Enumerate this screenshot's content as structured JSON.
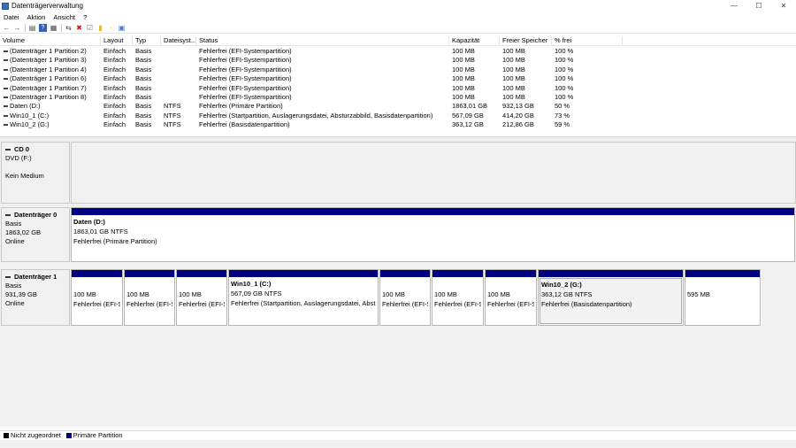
{
  "window": {
    "title": "Datenträgerverwaltung",
    "minimize": "—",
    "maximize": "☐",
    "close": "✕"
  },
  "menu": [
    "Datei",
    "Aktion",
    "Ansicht",
    "?"
  ],
  "toolbar": {
    "back": "←",
    "forward": "→",
    "list": "▤",
    "help": "?",
    "panes": "▦",
    "connect": "⇆",
    "delete": "✖",
    "properties": "☑",
    "folder": "▮",
    "new": "▫",
    "help2": "▣"
  },
  "volume_table": {
    "headers": {
      "volume": "Volume",
      "layout": "Layout",
      "type": "Typ",
      "fs": "Dateisyst...",
      "status": "Status",
      "capacity": "Kapazität",
      "free": "Freier Speicher",
      "pct": "% frei"
    },
    "rows": [
      {
        "volume": "(Datenträger 1 Partition 2)",
        "layout": "Einfach",
        "type": "Basis",
        "fs": "",
        "status": "Fehlerfrei (EFI-Systempartition)",
        "capacity": "100 MB",
        "free": "100 MB",
        "pct": "100 %"
      },
      {
        "volume": "(Datenträger 1 Partition 3)",
        "layout": "Einfach",
        "type": "Basis",
        "fs": "",
        "status": "Fehlerfrei (EFI-Systempartition)",
        "capacity": "100 MB",
        "free": "100 MB",
        "pct": "100 %"
      },
      {
        "volume": "(Datenträger 1 Partition 4)",
        "layout": "Einfach",
        "type": "Basis",
        "fs": "",
        "status": "Fehlerfrei (EFI-Systempartition)",
        "capacity": "100 MB",
        "free": "100 MB",
        "pct": "100 %"
      },
      {
        "volume": "(Datenträger 1 Partition 6)",
        "layout": "Einfach",
        "type": "Basis",
        "fs": "",
        "status": "Fehlerfrei (EFI-Systempartition)",
        "capacity": "100 MB",
        "free": "100 MB",
        "pct": "100 %"
      },
      {
        "volume": "(Datenträger 1 Partition 7)",
        "layout": "Einfach",
        "type": "Basis",
        "fs": "",
        "status": "Fehlerfrei (EFI-Systempartition)",
        "capacity": "100 MB",
        "free": "100 MB",
        "pct": "100 %"
      },
      {
        "volume": "(Datenträger 1 Partition 8)",
        "layout": "Einfach",
        "type": "Basis",
        "fs": "",
        "status": "Fehlerfrei (EFI-Systempartition)",
        "capacity": "100 MB",
        "free": "100 MB",
        "pct": "100 %"
      },
      {
        "volume": "Daten (D:)",
        "layout": "Einfach",
        "type": "Basis",
        "fs": "NTFS",
        "status": "Fehlerfrei (Primäre Partition)",
        "capacity": "1863,01 GB",
        "free": "932,13 GB",
        "pct": "50 %"
      },
      {
        "volume": "Win10_1 (C:)",
        "layout": "Einfach",
        "type": "Basis",
        "fs": "NTFS",
        "status": "Fehlerfrei (Startpartition, Auslagerungsdatei, Absturzabbild, Basisdatenpartition)",
        "capacity": "567,09 GB",
        "free": "414,20 GB",
        "pct": "73 %"
      },
      {
        "volume": "Win10_2 (G:)",
        "layout": "Einfach",
        "type": "Basis",
        "fs": "NTFS",
        "status": "Fehlerfrei (Basisdatenpartition)",
        "capacity": "363,12 GB",
        "free": "212,86 GB",
        "pct": "59 %"
      }
    ]
  },
  "disks": {
    "cd0": {
      "name": "CD 0",
      "line1": "DVD (F:)",
      "line2": "",
      "line3": "Kein Medium"
    },
    "disk0": {
      "name": "Datenträger 0",
      "line1": "Basis",
      "line2": "1863,02 GB",
      "line3": "Online",
      "partitions": [
        {
          "name": "Daten  (D:)",
          "size": "1863,01 GB NTFS",
          "status": "Fehlerfrei (Primäre Partition)"
        }
      ]
    },
    "disk1": {
      "name": "Datenträger 1",
      "line1": "Basis",
      "line2": "931,39 GB",
      "line3": "Online",
      "partitions": [
        {
          "name": "",
          "size": "100 MB",
          "status": "Fehlerfrei (EFI-S"
        },
        {
          "name": "",
          "size": "100 MB",
          "status": "Fehlerfrei (EFI-S"
        },
        {
          "name": "",
          "size": "100 MB",
          "status": "Fehlerfrei (EFI-S"
        },
        {
          "name": "Win10_1  (C:)",
          "size": "567,09 GB NTFS",
          "status": "Fehlerfrei (Startpartition, Auslagerungsdatei, Abst"
        },
        {
          "name": "",
          "size": "100 MB",
          "status": "Fehlerfrei (EFI-S"
        },
        {
          "name": "",
          "size": "100 MB",
          "status": "Fehlerfrei (EFI-S"
        },
        {
          "name": "",
          "size": "100 MB",
          "status": "Fehlerfrei (EFI-S"
        },
        {
          "name": "Win10_2  (G:)",
          "size": "363,12 GB NTFS",
          "status": "Fehlerfrei (Basisdatenpartition)"
        },
        {
          "name": "",
          "size": "595 MB",
          "status": ""
        }
      ]
    }
  },
  "legend": [
    {
      "label": "Nicht zugeordnet",
      "color": "#000000"
    },
    {
      "label": "Primäre Partition",
      "color": "#000080"
    }
  ],
  "colors": {
    "primary_partition": "#000080",
    "unallocated": "#000000"
  }
}
